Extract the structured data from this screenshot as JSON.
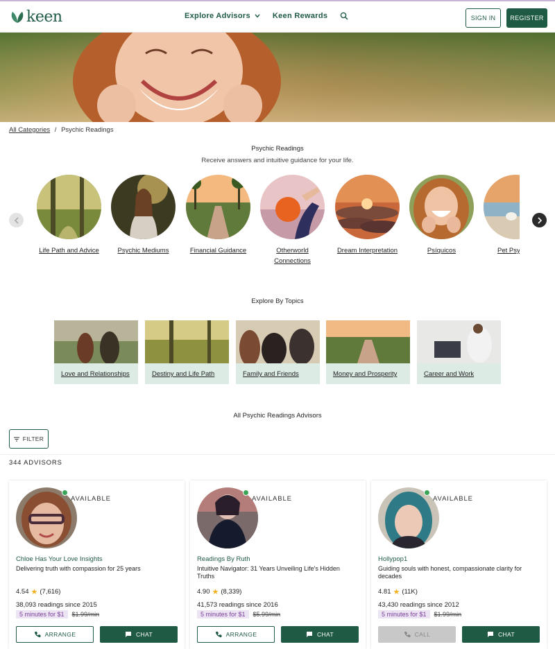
{
  "header": {
    "logo_text": "keen",
    "nav": [
      {
        "label": "Explore Advisors"
      },
      {
        "label": "Keen Rewards"
      }
    ],
    "sign_in": "SIGN IN",
    "register": "REGISTER"
  },
  "breadcrumb": {
    "root": "All Categories",
    "separator": "/",
    "current": "Psychic Readings"
  },
  "categories_section": {
    "title": "Psychic Readings",
    "subtitle": "Receive answers and intuitive guidance for your life.",
    "items": [
      {
        "label": "Life Path and Advice"
      },
      {
        "label": "Psychic Mediums"
      },
      {
        "label": "Financial Guidance"
      },
      {
        "label_line1": "Otherworld",
        "label_line2": "Connections"
      },
      {
        "label": "Dream Interpretation"
      },
      {
        "label": "Psíquicos"
      },
      {
        "label": "Pet Psy"
      }
    ]
  },
  "topics_section": {
    "title": "Explore By Topics",
    "items": [
      {
        "label": "Love and Relationships"
      },
      {
        "label": "Destiny and Life Path"
      },
      {
        "label": "Family and Friends"
      },
      {
        "label": "Money and Prosperity"
      },
      {
        "label": "Career and Work"
      }
    ]
  },
  "advisors_section": {
    "title": "All Psychic Readings Advisors",
    "filter_label": "FILTER",
    "count": "344 ADVISORS"
  },
  "advisors": [
    {
      "status": "AVAILABLE",
      "name": "Chloe Has Your Love Insights",
      "tagline": "Delivering truth with compassion for 25 years",
      "rating": "4.54",
      "reviews": "(7,616)",
      "readings": "38,093 readings since 2015",
      "promo": "5 minutes for $1",
      "price": "$1.99/min",
      "left_button": "ARRANGE",
      "right_button": "CHAT"
    },
    {
      "status": "AVAILABLE",
      "name": "Readings By Ruth",
      "tagline": "Intuitive Navigator: 31 Years Unveiling Life's Hidden Truths",
      "rating": "4.90",
      "reviews": "(8,339)",
      "readings": "41,573 readings since 2016",
      "promo": "5 minutes for $1",
      "price": "$5.99/min",
      "left_button": "ARRANGE",
      "right_button": "CHAT"
    },
    {
      "status": "AVAILABLE",
      "name": "Hollypop1",
      "tagline": "Guiding souls with honest, compassionate clarity for decades",
      "rating": "4.81",
      "reviews": "(11K)",
      "readings": "43,430 readings since 2012",
      "promo": "5 minutes for $1",
      "price": "$1.99/min",
      "left_button": "CALL",
      "right_button": "CHAT"
    }
  ],
  "colors": {
    "brand": "#1f5a45",
    "promo_bg": "#ece3f3",
    "topic_bg": "#dcece5",
    "online": "#3aa556"
  }
}
